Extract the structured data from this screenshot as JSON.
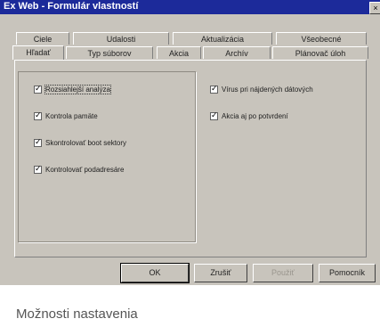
{
  "window": {
    "title": "Ex Web - Formulár vlastností",
    "close_label": "×"
  },
  "tabs_row1": [
    "Ciele",
    "Udalosti",
    "Aktualizácia",
    "Všeobecné"
  ],
  "tabs_row2": [
    "Hľadať",
    "Typ súborov",
    "Akcia",
    "Archív",
    "Plánovač úloh"
  ],
  "checkboxes_left": [
    {
      "label": "Rozsiahlejší analýza",
      "checked": true
    },
    {
      "label": "Kontrola pamäte",
      "checked": true
    },
    {
      "label": "Skontrolovať boot sektory",
      "checked": true
    },
    {
      "label": "Kontrolovať podadresáre",
      "checked": true
    }
  ],
  "checkboxes_right": [
    {
      "label": "Vírus pri nájdených dátových",
      "checked": true
    },
    {
      "label": "Akcia aj po potvrdení",
      "checked": true
    }
  ],
  "buttons": {
    "ok": "OK",
    "cancel": "Zrušiť",
    "apply": "Použiť",
    "help": "Pomocník"
  },
  "caption": "Možnosti nastavenia"
}
